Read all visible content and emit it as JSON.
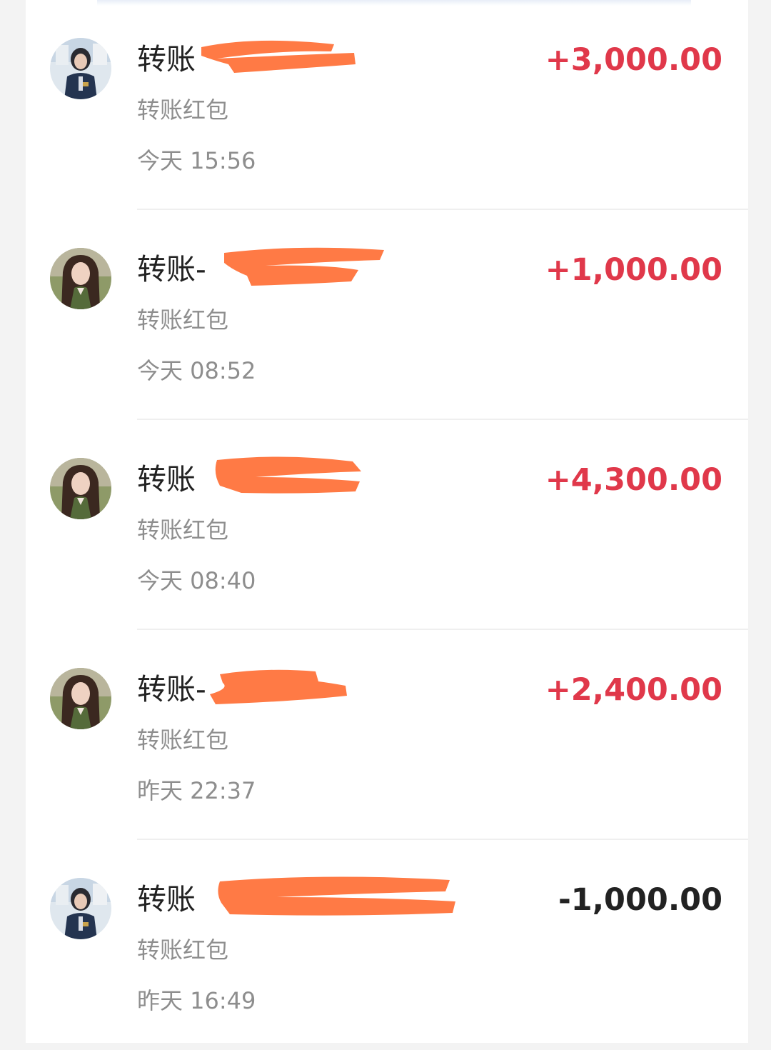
{
  "transactions": [
    {
      "title": "转账",
      "subtitle": "转账红包",
      "time": "今天 15:56",
      "amount": "+3,000.00",
      "direction": "income",
      "avatar": "avatar-photo-uniform"
    },
    {
      "title": "转账-",
      "subtitle": "转账红包",
      "time": "今天 08:52",
      "amount": "+1,000.00",
      "direction": "income",
      "avatar": "avatar-photo-woman"
    },
    {
      "title": "转账",
      "subtitle": "转账红包",
      "time": "今天 08:40",
      "amount": "+4,300.00",
      "direction": "income",
      "avatar": "avatar-photo-woman"
    },
    {
      "title": "转账-",
      "subtitle": "转账红包",
      "time": "昨天 22:37",
      "amount": "+2,400.00",
      "direction": "income",
      "avatar": "avatar-photo-woman"
    },
    {
      "title": "转账",
      "subtitle": "转账红包",
      "time": "昨天 16:49",
      "amount": "-1,000.00",
      "direction": "expense",
      "avatar": "avatar-photo-uniform"
    }
  ],
  "colors": {
    "income": "#e0384a",
    "expense": "#222222",
    "redaction": "#ff7a45"
  }
}
